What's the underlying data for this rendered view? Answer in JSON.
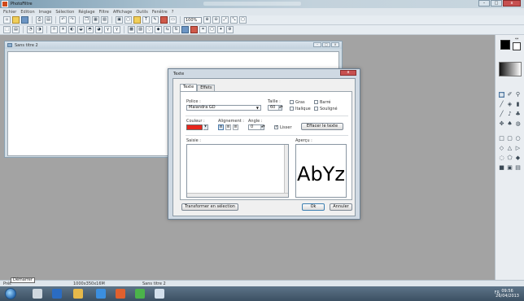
{
  "app": {
    "title": "PhotoFiltre",
    "window_controls": [
      "–",
      "□",
      "x"
    ]
  },
  "menu": [
    "Fichier",
    "Edition",
    "Image",
    "Sélection",
    "Réglage",
    "Filtre",
    "Affichage",
    "Outils",
    "Fenêtre",
    "?"
  ],
  "toolbar": {
    "zoom_value": "100%",
    "text_tool_label": "T"
  },
  "document": {
    "title": "Sans titre 2",
    "controls": [
      "–",
      "□",
      "x"
    ]
  },
  "status": {
    "state": "Prêt",
    "image_size": "1000x350x16M",
    "doc_name": "Sans titre 2"
  },
  "start_tooltip": "Démarrer",
  "taskbar": {
    "tray_lang": "FR",
    "clock_time": "09:56",
    "clock_date": "26/04/2013"
  },
  "dialog": {
    "title": "Texte",
    "close": "x",
    "tabs": [
      "Texte",
      "Effets"
    ],
    "active_tab": "Texte",
    "font_label": "Police :",
    "font_value": "Maiandra GD",
    "size_label": "Taille :",
    "size_value": "60",
    "bold_label": "Gras",
    "italic_label": "Italique",
    "strike_label": "Barré",
    "underline_label": "Souligné",
    "color_label": "Couleur :",
    "color_value": "#e8261b",
    "align_label": "Alignement :",
    "angle_label": "Angle :",
    "angle_value": "0",
    "smooth_label": "Lisser",
    "smooth_checked": true,
    "clear_button": "Effacer le texte",
    "input_label": "Saisie :",
    "preview_label": "Aperçu :",
    "preview_text": "AbYz",
    "transform_button": "Transformer en sélection",
    "ok_button": "Ok",
    "cancel_button": "Annuler"
  }
}
